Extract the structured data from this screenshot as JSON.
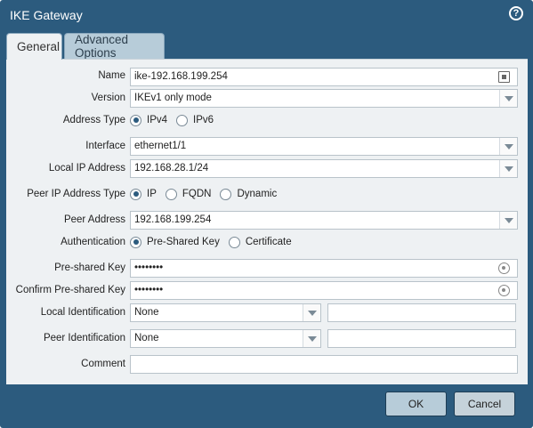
{
  "window": {
    "title": "IKE Gateway",
    "help_icon": "?"
  },
  "tabs": [
    {
      "label": "General"
    },
    {
      "label": "Advanced Options"
    }
  ],
  "form": {
    "name": {
      "label": "Name",
      "value": "ike-192.168.199.254"
    },
    "version": {
      "label": "Version",
      "value": "IKEv1 only mode"
    },
    "address_type": {
      "label": "Address Type",
      "options": [
        "IPv4",
        "IPv6"
      ],
      "selected": "IPv4"
    },
    "interface": {
      "label": "Interface",
      "value": "ethernet1/1"
    },
    "local_ip": {
      "label": "Local IP Address",
      "value": "192.168.28.1/24"
    },
    "peer_ip_type": {
      "label": "Peer IP Address Type",
      "options": [
        "IP",
        "FQDN",
        "Dynamic"
      ],
      "selected": "IP"
    },
    "peer_address": {
      "label": "Peer Address",
      "value": "192.168.199.254"
    },
    "authentication": {
      "label": "Authentication",
      "options": [
        "Pre-Shared Key",
        "Certificate"
      ],
      "selected": "Pre-Shared Key"
    },
    "preshared_key": {
      "label": "Pre-shared Key",
      "value": "••••••••"
    },
    "confirm_key": {
      "label": "Confirm Pre-shared Key",
      "value": "••••••••"
    },
    "local_identification": {
      "label": "Local Identification",
      "value": "None",
      "text": ""
    },
    "peer_identification": {
      "label": "Peer Identification",
      "value": "None",
      "text": ""
    },
    "comment": {
      "label": "Comment",
      "value": ""
    }
  },
  "buttons": {
    "ok": "OK",
    "cancel": "Cancel"
  }
}
